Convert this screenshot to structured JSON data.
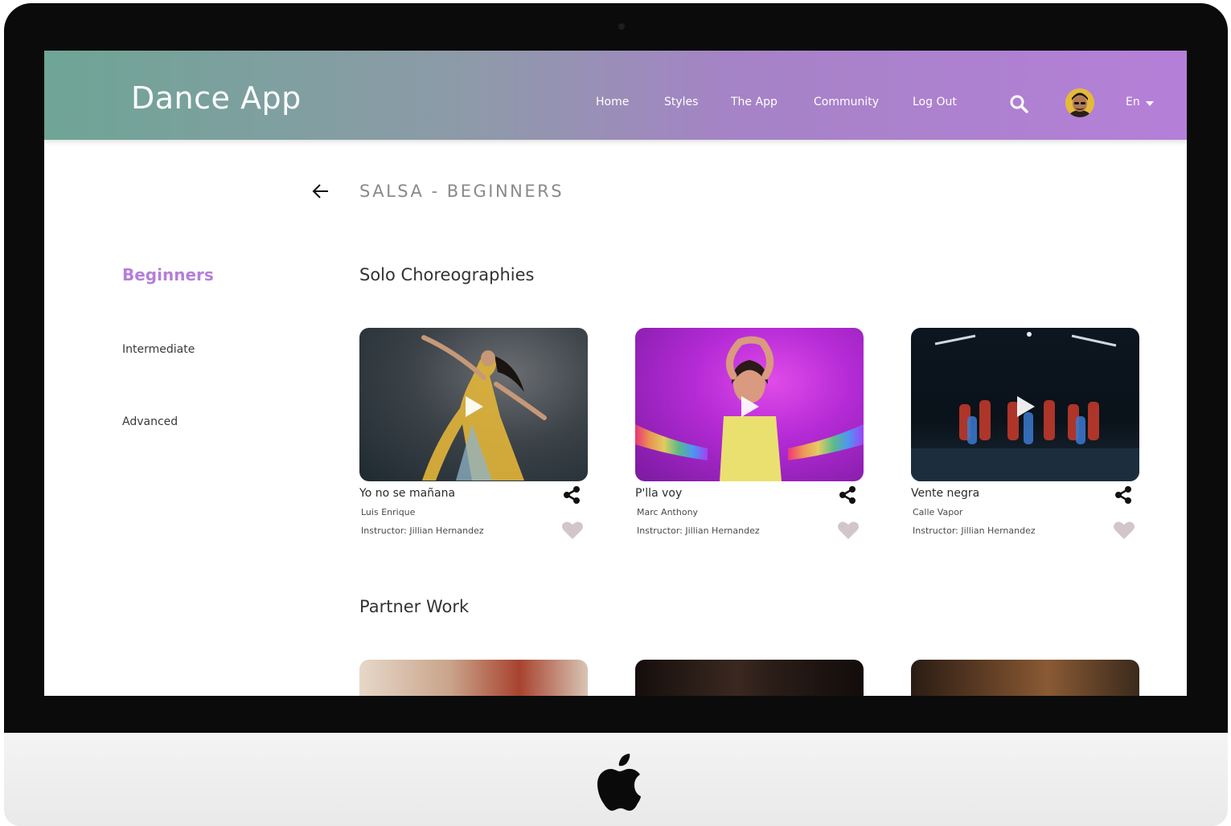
{
  "app": {
    "brand": "Dance App"
  },
  "nav": {
    "items": [
      "Home",
      "Styles",
      "The App",
      "Community",
      "Log Out"
    ],
    "language": "En"
  },
  "page": {
    "title": "SALSA - BEGINNERS"
  },
  "sidebar": {
    "items": [
      "Beginners",
      "Intermediate",
      "Advanced"
    ],
    "active": "Beginners"
  },
  "sections": [
    {
      "title": "Solo Choreographies",
      "videos": [
        {
          "song": "Yo no se mañana",
          "artist": "Luis Enrique",
          "instructor": "Instructor: Jillian Hernandez"
        },
        {
          "song": "P'lla voy",
          "artist": "Marc Anthony",
          "instructor": "Instructor: Jillian Hernandez"
        },
        {
          "song": "Vente negra",
          "artist": "Calle Vapor",
          "instructor": "Instructor: Jillian Hernandez"
        }
      ]
    },
    {
      "title": "Partner Work",
      "videos": []
    }
  ],
  "colors": {
    "accent": "#b57fd8",
    "header_start": "#6ea595",
    "header_end": "#b57fd8",
    "heart": "#d3c6c8"
  },
  "icons": [
    "search-icon",
    "back-arrow-icon",
    "play-icon",
    "share-icon",
    "heart-icon",
    "chevron-down-icon",
    "apple-logo"
  ]
}
